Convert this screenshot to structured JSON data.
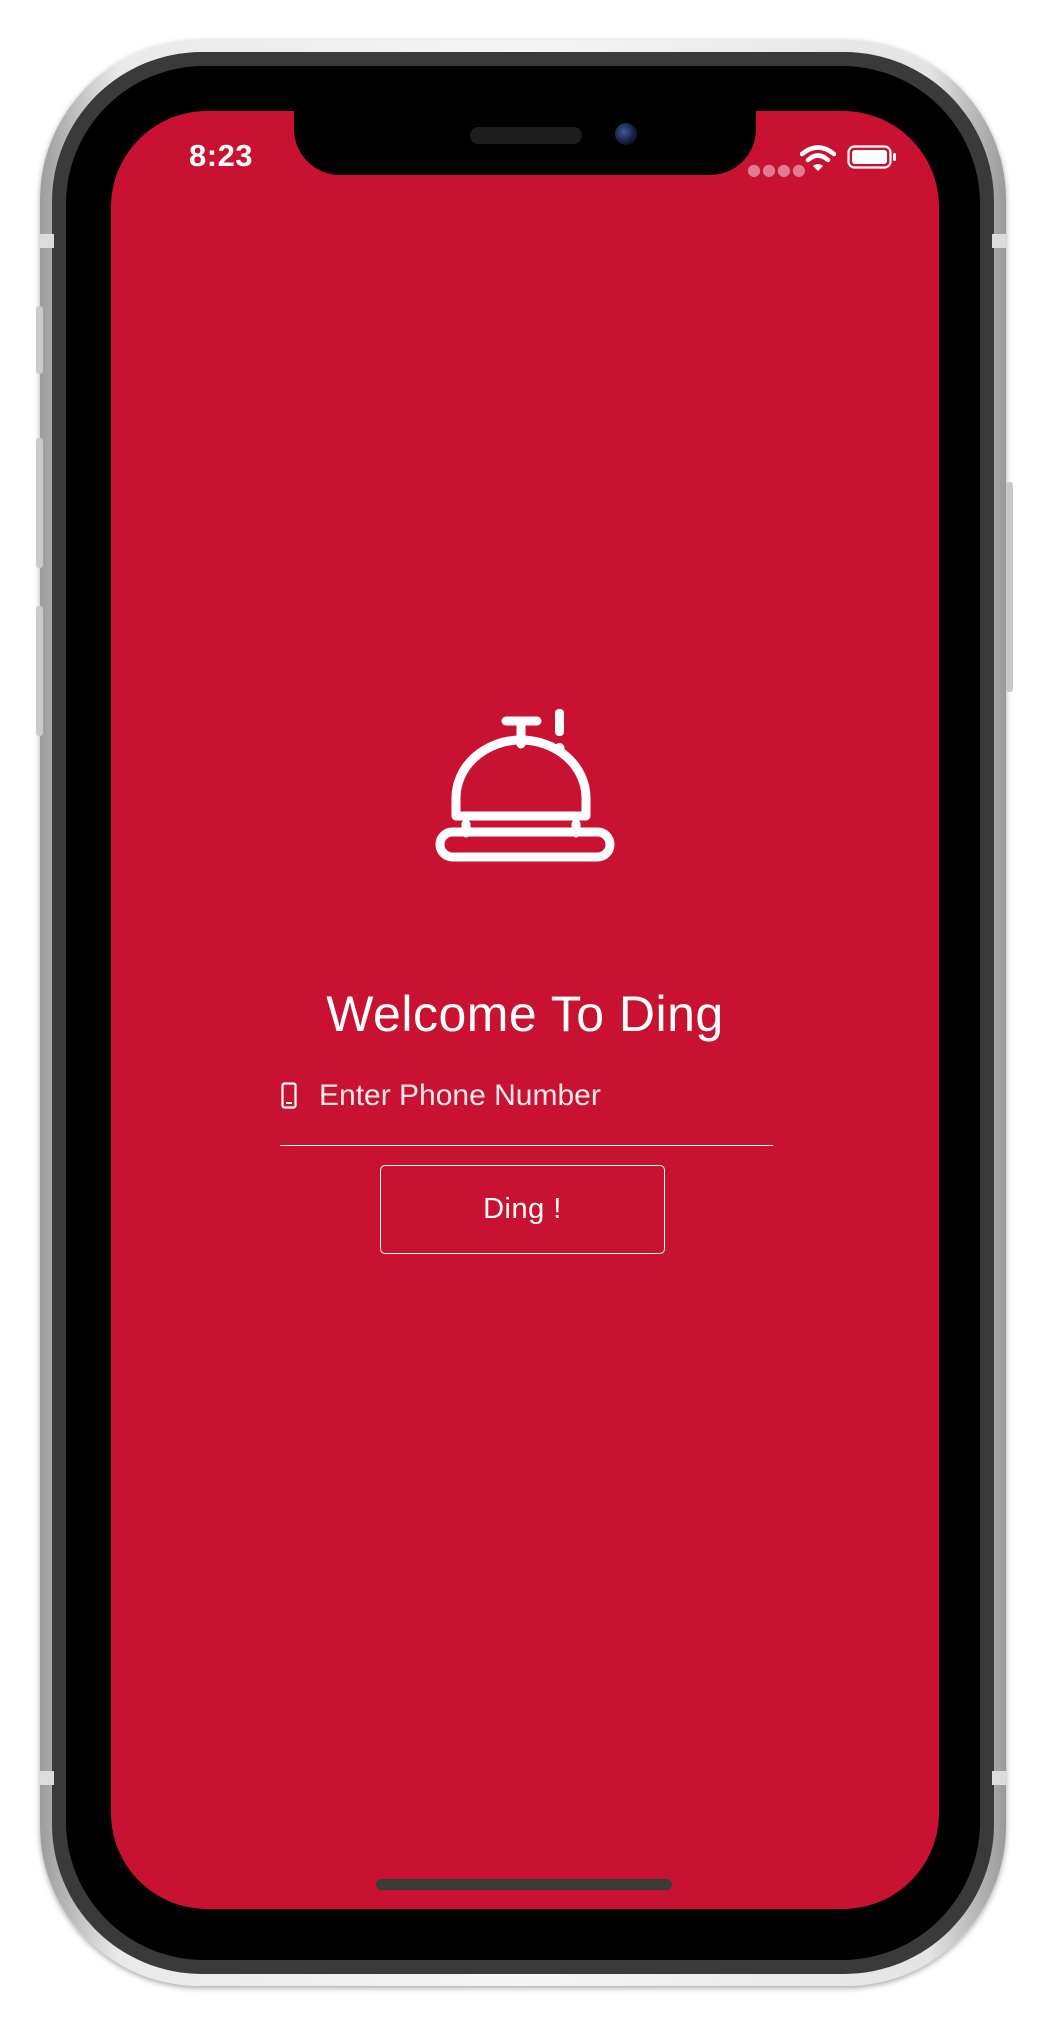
{
  "status_bar": {
    "time": "8:23"
  },
  "login": {
    "welcome_title": "Welcome To Ding",
    "phone_placeholder": "Enter Phone Number",
    "submit_label": "Ding !"
  },
  "icons": {
    "app_logo": "service-bell-icon",
    "phone_field": "mobile-phone-icon",
    "wifi": "wifi-icon",
    "battery": "battery-icon",
    "signal": "cellular-signal-icon"
  },
  "colors": {
    "background": "#c91232",
    "foreground": "#ffffff",
    "home_indicator": "#3a3a3a"
  }
}
